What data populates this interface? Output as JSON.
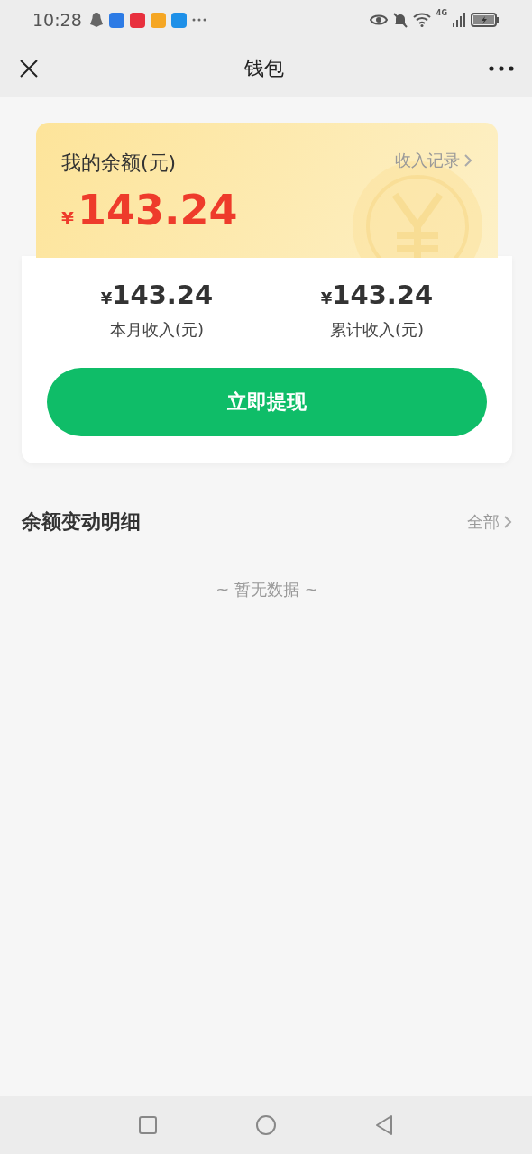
{
  "status_bar": {
    "time": "10:28",
    "network": "4G"
  },
  "nav": {
    "title": "钱包"
  },
  "balance": {
    "label": "我的余额(元)",
    "currency": "¥",
    "amount": "143.24",
    "link": "收入记录"
  },
  "stats": [
    {
      "currency": "¥",
      "value": "143.24",
      "label": "本月收入(元)"
    },
    {
      "currency": "¥",
      "value": "143.24",
      "label": "累计收入(元)"
    }
  ],
  "withdraw_button": "立即提现",
  "details": {
    "title": "余额变动明细",
    "link": "全部",
    "empty_text": "~ 暂无数据 ~"
  }
}
